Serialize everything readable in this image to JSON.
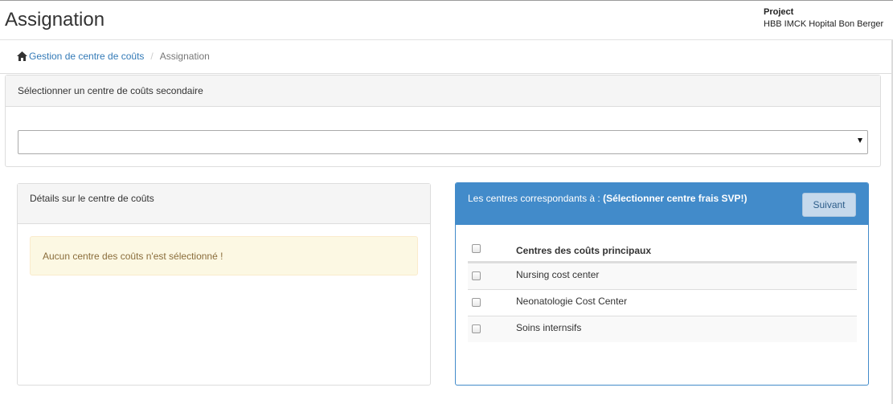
{
  "header": {
    "title": "Assignation",
    "project_label": "Project",
    "project_name": "HBB IMCK Hopital Bon Berger"
  },
  "breadcrumb": {
    "home_icon": "home-icon",
    "parent": "Gestion de centre de coûts",
    "separator": "/",
    "current": "Assignation"
  },
  "select_panel": {
    "heading": "Sélectionner un centre de coûts secondaire",
    "selected_value": ""
  },
  "details_panel": {
    "heading": "Détails sur le centre de coûts",
    "alert": "Aucun centre des coûts n'est sélectionné !"
  },
  "centres_panel": {
    "heading_prefix": "Les centres correspondants à : ",
    "heading_strong": "(Sélectionner centre frais SVP!)",
    "next_button": "Suivant",
    "column_header": "Centres des coûts principaux",
    "rows": [
      {
        "label": "Nursing cost center",
        "checked": false
      },
      {
        "label": "Neonatologie Cost Center",
        "checked": false
      },
      {
        "label": "Soins internsifs",
        "checked": false
      }
    ]
  },
  "colors": {
    "primary": "#428bca",
    "link": "#337ab7",
    "warning_text": "#8a6d3b",
    "warning_bg": "#fcf8e3"
  }
}
